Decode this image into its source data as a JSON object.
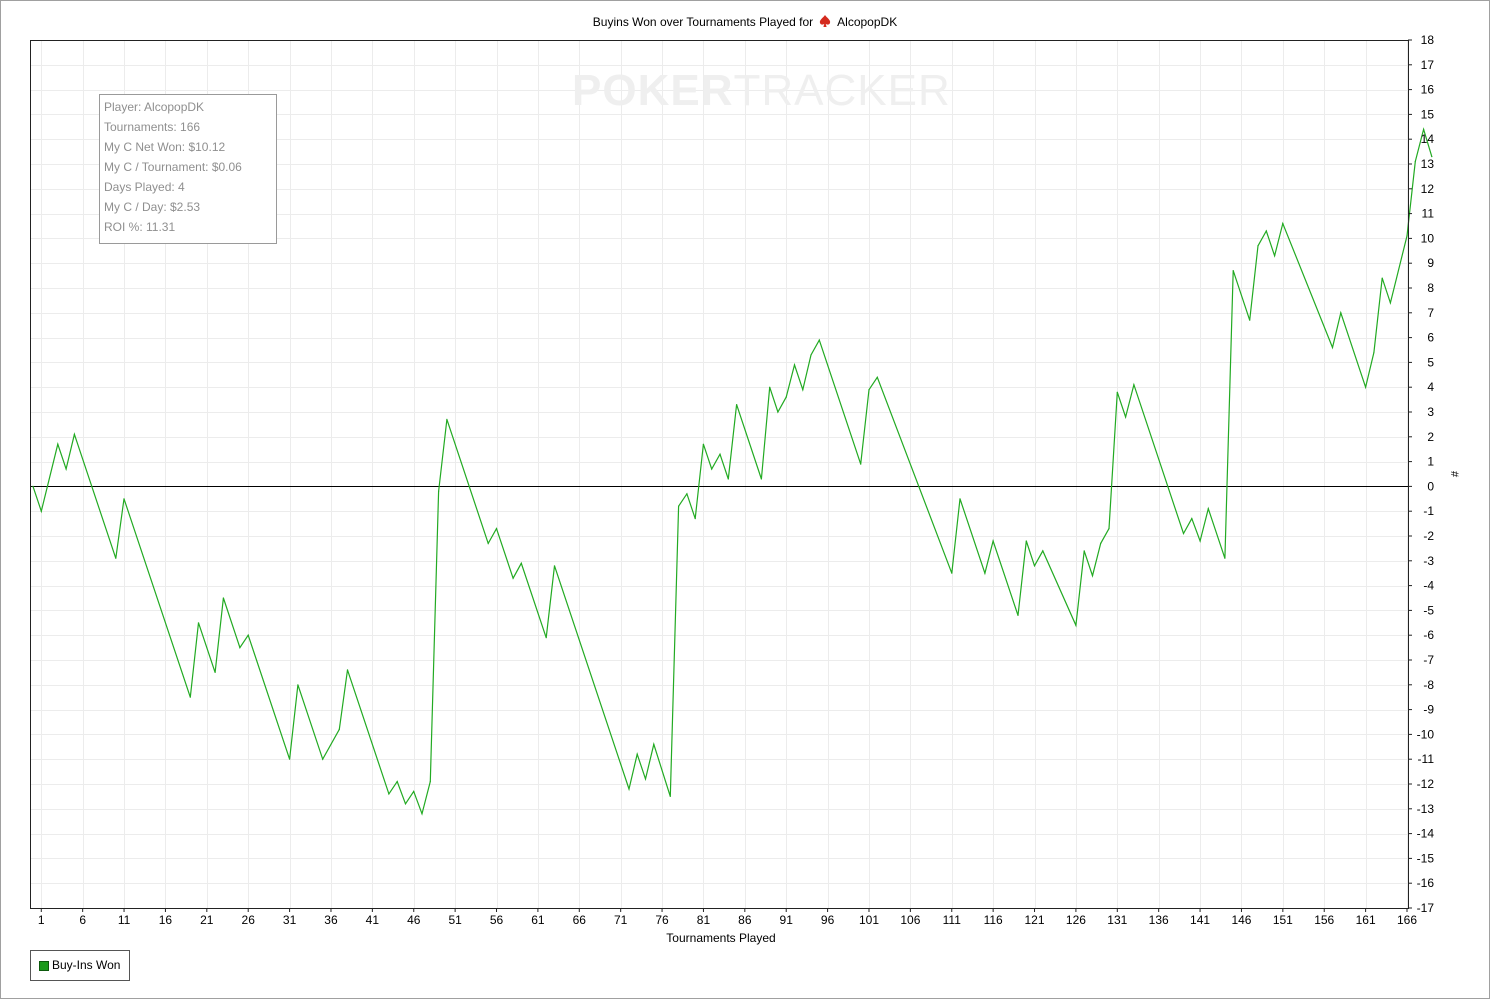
{
  "title": {
    "prefix": "Buyins Won over Tournaments Played for",
    "player": "AlcopopDK",
    "icon": "spade-icon"
  },
  "watermark": {
    "bold": "POKER",
    "light": "TRACKER"
  },
  "info_box": [
    "Player: AlcopopDK",
    "Tournaments: 166",
    "My C Net Won: $10.12",
    "My C / Tournament: $0.06",
    "Days Played: 4",
    "My C / Day: $2.53",
    "ROI %: 11.31"
  ],
  "legend": {
    "label": "Buy-Ins Won",
    "color": "#1a9a1a"
  },
  "colors": {
    "line": "#22aa22",
    "grid": "#ececec",
    "zero_line": "#000000"
  },
  "chart_data": {
    "type": "line",
    "xlabel": "Tournaments Played",
    "ylabel": "#",
    "xlim": [
      0,
      166
    ],
    "ylim": [
      -17,
      18
    ],
    "x_ticks": [
      1,
      6,
      11,
      16,
      21,
      26,
      31,
      36,
      41,
      46,
      51,
      56,
      61,
      66,
      71,
      76,
      81,
      86,
      91,
      96,
      101,
      106,
      111,
      116,
      121,
      126,
      131,
      136,
      141,
      146,
      151,
      156,
      161,
      166
    ],
    "y_ticks": [
      -17,
      -16,
      -15,
      -14,
      -13,
      -12,
      -11,
      -10,
      -9,
      -8,
      -7,
      -6,
      -5,
      -4,
      -3,
      -2,
      -1,
      0,
      1,
      2,
      3,
      4,
      5,
      6,
      7,
      8,
      9,
      10,
      11,
      12,
      13,
      14,
      15,
      16,
      17,
      18
    ],
    "grid": true,
    "legend_position": "bottom-left",
    "series": [
      {
        "name": "Buy-Ins Won",
        "points": [
          [
            0,
            0
          ],
          [
            1,
            -1
          ],
          [
            3,
            1.7
          ],
          [
            4,
            0.7
          ],
          [
            5,
            2.1
          ],
          [
            10,
            -2.9
          ],
          [
            11,
            -0.5
          ],
          [
            19,
            -8.5
          ],
          [
            20,
            -5.5
          ],
          [
            22,
            -7.5
          ],
          [
            23,
            -4.5
          ],
          [
            25,
            -6.5
          ],
          [
            26,
            -6.0
          ],
          [
            31,
            -11.0
          ],
          [
            32,
            -8.0
          ],
          [
            35,
            -11.0
          ],
          [
            37,
            -9.8
          ],
          [
            38,
            -7.4
          ],
          [
            43,
            -12.4
          ],
          [
            44,
            -11.9
          ],
          [
            45,
            -12.8
          ],
          [
            46,
            -12.3
          ],
          [
            47,
            -13.2
          ],
          [
            48,
            -11.9
          ],
          [
            49,
            -0.2
          ],
          [
            50,
            2.7
          ],
          [
            55,
            -2.3
          ],
          [
            56,
            -1.7
          ],
          [
            58,
            -3.7
          ],
          [
            59,
            -3.1
          ],
          [
            62,
            -6.1
          ],
          [
            63,
            -3.2
          ],
          [
            72,
            -12.2
          ],
          [
            73,
            -10.8
          ],
          [
            74,
            -11.8
          ],
          [
            75,
            -10.4
          ],
          [
            77,
            -12.5
          ],
          [
            78,
            -0.8
          ],
          [
            79,
            -0.3
          ],
          [
            80,
            -1.3
          ],
          [
            81,
            1.7
          ],
          [
            82,
            0.7
          ],
          [
            83,
            1.3
          ],
          [
            84,
            0.3
          ],
          [
            85,
            3.3
          ],
          [
            88,
            0.3
          ],
          [
            89,
            4.0
          ],
          [
            90,
            3.0
          ],
          [
            91,
            3.6
          ],
          [
            92,
            4.9
          ],
          [
            93,
            3.9
          ],
          [
            94,
            5.3
          ],
          [
            95,
            5.9
          ],
          [
            100,
            0.9
          ],
          [
            101,
            3.9
          ],
          [
            102,
            4.4
          ],
          [
            111,
            -3.5
          ],
          [
            112,
            -0.5
          ],
          [
            115,
            -3.5
          ],
          [
            116,
            -2.2
          ],
          [
            119,
            -5.2
          ],
          [
            120,
            -2.2
          ],
          [
            121,
            -3.2
          ],
          [
            122,
            -2.6
          ],
          [
            126,
            -5.6
          ],
          [
            127,
            -2.6
          ],
          [
            128,
            -3.6
          ],
          [
            129,
            -2.3
          ],
          [
            130,
            -1.7
          ],
          [
            131,
            3.8
          ],
          [
            132,
            2.8
          ],
          [
            133,
            4.1
          ],
          [
            139,
            -1.9
          ],
          [
            140,
            -1.3
          ],
          [
            141,
            -2.2
          ],
          [
            142,
            -0.9
          ],
          [
            144,
            -2.9
          ],
          [
            145,
            8.7
          ],
          [
            147,
            6.7
          ],
          [
            148,
            9.7
          ],
          [
            149,
            10.3
          ],
          [
            150,
            9.3
          ],
          [
            151,
            10.6
          ],
          [
            157,
            5.6
          ],
          [
            158,
            7.0
          ],
          [
            161,
            4.0
          ],
          [
            162,
            5.4
          ],
          [
            163,
            8.4
          ],
          [
            164,
            7.4
          ],
          [
            166,
            10.1
          ],
          [
            167,
            13.1
          ],
          [
            168,
            14.4
          ],
          [
            169,
            13.3
          ]
        ]
      }
    ]
  }
}
